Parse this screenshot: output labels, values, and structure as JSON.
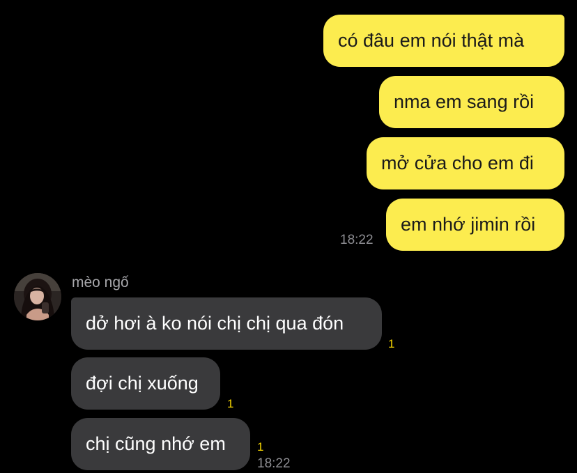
{
  "outgoing": [
    {
      "text": "có đâu em nói thật mà"
    },
    {
      "text": "nma em sang rồi"
    },
    {
      "text": "mở cửa cho em đi"
    },
    {
      "text": "em nhớ jimin rồi"
    }
  ],
  "outgoing_time": "18:22",
  "contact": {
    "name": "mèo ngố",
    "avatar": "profile-photo"
  },
  "incoming": [
    {
      "text": "dở hơi à ko nói chị chị qua đón",
      "unread": "1"
    },
    {
      "text": "đợi chị xuống",
      "unread": "1"
    },
    {
      "text": "chị cũng nhớ em",
      "unread": "1"
    }
  ],
  "incoming_time": "18:22",
  "colors": {
    "background": "#000000",
    "outgoing_bubble": "#fcec4f",
    "incoming_bubble": "#3a3a3c",
    "unread_count": "#f5d400",
    "timestamp": "#8e8e93"
  }
}
